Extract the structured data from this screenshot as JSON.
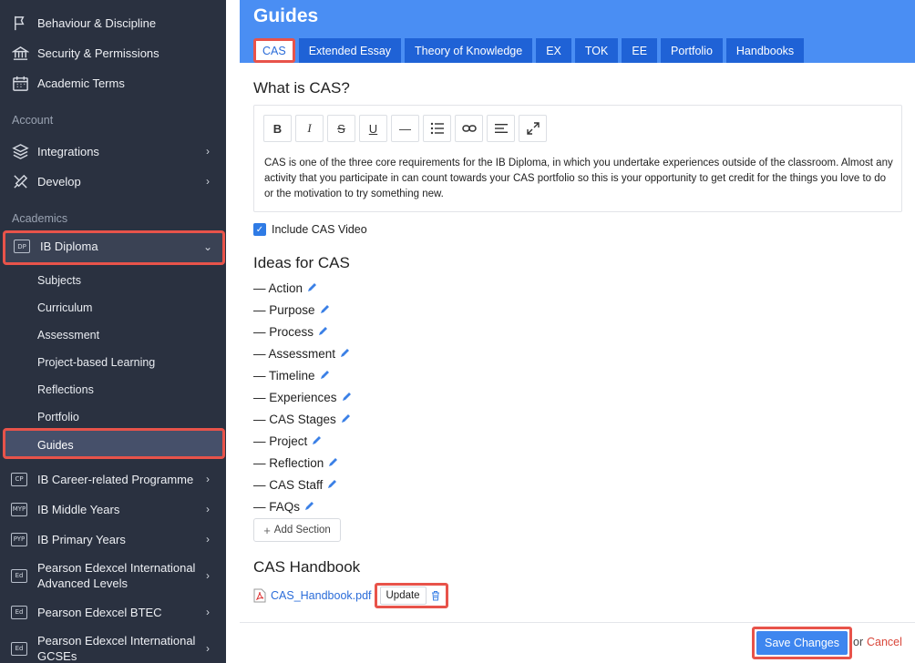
{
  "sidebar": {
    "top_items": [
      {
        "label": "Behaviour & Discipline",
        "icon": "flag-icon"
      },
      {
        "label": "Security & Permissions",
        "icon": "bank-icon"
      },
      {
        "label": "Academic Terms",
        "icon": "calendar-icon"
      }
    ],
    "account_header": "Account",
    "account_items": [
      {
        "label": "Integrations",
        "icon": "layers-icon"
      },
      {
        "label": "Develop",
        "icon": "tools-icon"
      }
    ],
    "academics_header": "Academics",
    "ib_diploma": {
      "label": "IB Diploma",
      "badge": "DP"
    },
    "ib_sub": [
      "Subjects",
      "Curriculum",
      "Assessment",
      "Project-based Learning",
      "Reflections",
      "Portfolio",
      "Guides"
    ],
    "programmes": [
      {
        "label": "IB Career-related Programme",
        "badge": "CP"
      },
      {
        "label": "IB Middle Years",
        "badge": "MYP"
      },
      {
        "label": "IB Primary Years",
        "badge": "PYP"
      },
      {
        "label_line1": "Pearson Edexcel International",
        "label_line2": "Advanced Levels",
        "badge": "Ed"
      },
      {
        "label": "Pearson Edexcel BTEC",
        "badge": "Ed"
      },
      {
        "label_line1": "Pearson Edexcel International",
        "label_line2": "GCSEs",
        "badge": "Ed"
      }
    ]
  },
  "main": {
    "title": "Guides",
    "tabs": [
      "CAS",
      "Extended Essay",
      "Theory of Knowledge",
      "EX",
      "TOK",
      "EE",
      "Portfolio",
      "Handbooks"
    ],
    "what_heading": "What is CAS?",
    "toolbar": [
      "B",
      "I",
      "S",
      "U",
      "—",
      "list",
      "link",
      "align",
      "expand"
    ],
    "editor_text": "CAS is one of the three core requirements for the IB Diploma, in which you undertake experiences outside of the classroom. Almost any activity that you participate in can count towards your CAS portfolio so this is your opportunity to get credit for the things you love to do or the motivation to try something new.",
    "include_video_label": "Include CAS Video",
    "ideas_heading": "Ideas for CAS",
    "ideas": [
      "— Action",
      "— Purpose",
      "— Process",
      "— Assessment",
      "— Timeline",
      "— Experiences",
      "— CAS Stages",
      "— Project",
      "— Reflection",
      "— CAS Staff",
      "— FAQs"
    ],
    "add_section_label": "Add Section",
    "handbook_heading": "CAS Handbook",
    "handbook_file": "CAS_Handbook.pdf",
    "update_label": "Update",
    "save_label": "Save Changes",
    "or_label": "or",
    "cancel_label": "Cancel"
  },
  "colors": {
    "accent": "#4a8ef3",
    "tab": "#1f62d6",
    "highlight": "#e8534a",
    "sidebar": "#2a3140"
  }
}
